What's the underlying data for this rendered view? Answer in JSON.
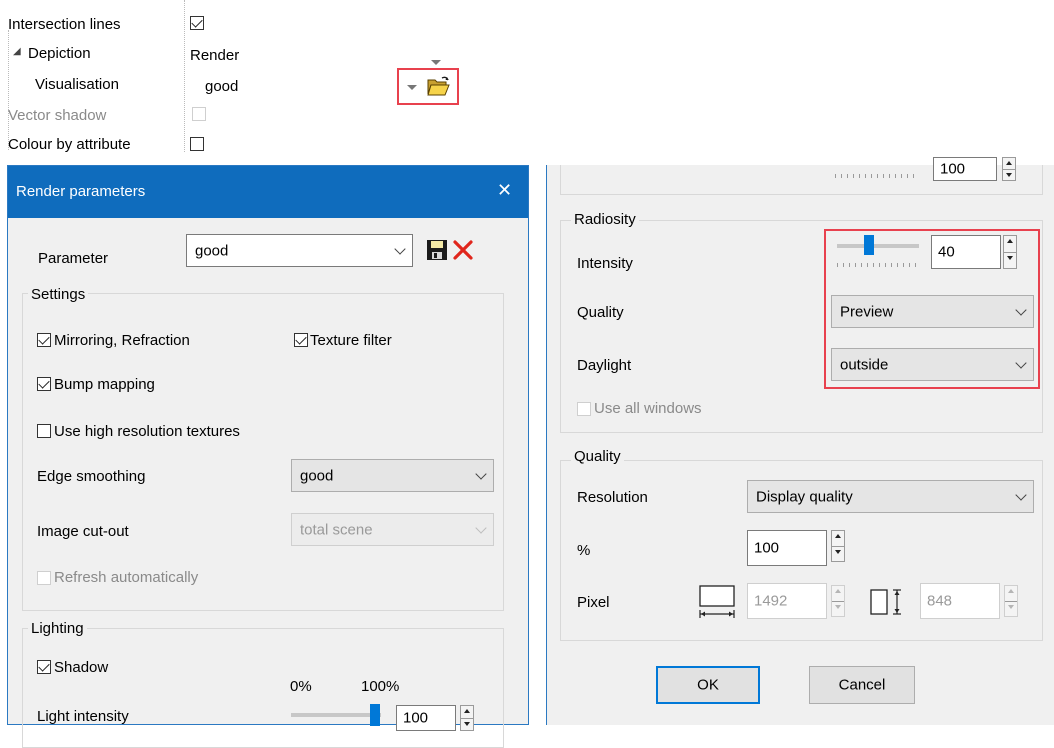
{
  "props": {
    "rows": [
      {
        "label": "Intersection lines",
        "value": "",
        "checked": true
      },
      {
        "label": "Depiction",
        "value": "Render"
      },
      {
        "label": "Visualisation",
        "value": "good"
      },
      {
        "label": "Vector shadow",
        "value": ""
      },
      {
        "label": "Colour by attribute",
        "value": ""
      }
    ],
    "expander": "◢"
  },
  "render_dialog": {
    "title": "Render parameters",
    "close": "✕",
    "parameter_label": "Parameter",
    "parameter_value": "good",
    "settings_title": "Settings",
    "mirroring": "Mirroring, Refraction",
    "texture_filter": "Texture filter",
    "bump_mapping": "Bump mapping",
    "high_res": "Use high resolution textures",
    "edge_label": "Edge smoothing",
    "edge_value": "good",
    "cutout_label": "Image cut-out",
    "cutout_value": "total scene",
    "refresh": "Refresh automatically",
    "lighting_title": "Lighting",
    "shadow": "Shadow",
    "pct0": "0%",
    "pct100": "100%",
    "light_label": "Light intensity",
    "light_value": "100"
  },
  "right_panel": {
    "top_value": "100",
    "radiosity_title": "Radiosity",
    "intensity_label": "Intensity",
    "intensity_value": "40",
    "intensity_level": 0.4,
    "quality_label": "Quality",
    "quality_value": "Preview",
    "daylight_label": "Daylight",
    "daylight_value": "outside",
    "use_all_windows": "Use all windows",
    "quality_title": "Quality",
    "resolution_label": "Resolution",
    "resolution_value": "Display quality",
    "percent_label": "%",
    "percent_value": "100",
    "pixel_label": "Pixel",
    "width_value": "1492",
    "height_value": "848",
    "ok": "OK",
    "cancel": "Cancel"
  },
  "colors": {
    "titlebar": "#0f6cbd",
    "highlight": "#e8414e",
    "slider_thumb": "#0078d7"
  }
}
